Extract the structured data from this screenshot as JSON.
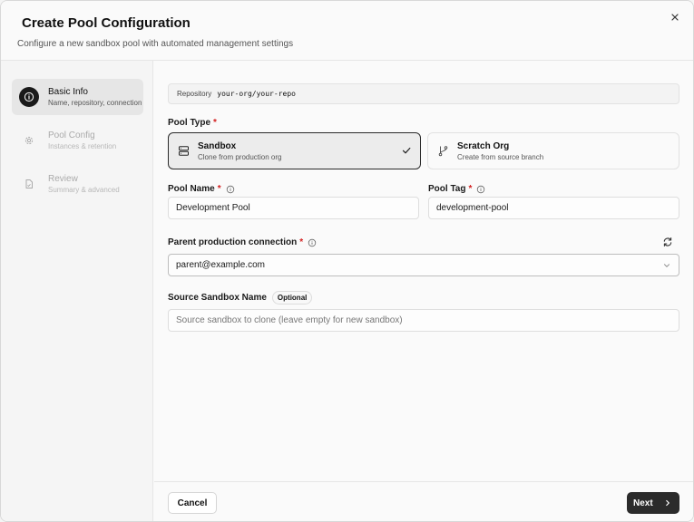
{
  "dialog": {
    "title": "Create Pool Configuration",
    "subtitle": "Configure a new sandbox pool with automated management settings"
  },
  "steps": [
    {
      "label": "Basic Info",
      "description": "Name, repository, connection",
      "active": true,
      "icon": "info-icon"
    },
    {
      "label": "Pool Config",
      "description": "Instances & retention",
      "active": false,
      "icon": "gear-icon"
    },
    {
      "label": "Review",
      "description": "Summary & advanced",
      "active": false,
      "icon": "document-icon"
    }
  ],
  "repository": {
    "label": "Repository",
    "value": "your-org/your-repo"
  },
  "pool_type": {
    "label": "Pool Type",
    "required_mark": "*",
    "options": [
      {
        "title": "Sandbox",
        "description": "Clone from production org",
        "selected": true,
        "icon": "server-icon"
      },
      {
        "title": "Scratch Org",
        "description": "Create from source branch",
        "selected": false,
        "icon": "git-branch-icon"
      }
    ]
  },
  "pool_name": {
    "label": "Pool Name",
    "required_mark": "*",
    "value": "Development Pool"
  },
  "pool_tag": {
    "label": "Pool Tag",
    "required_mark": "*",
    "value": "development-pool"
  },
  "parent_connection": {
    "label": "Parent production connection",
    "required_mark": "*",
    "value": "parent@example.com"
  },
  "source_sandbox": {
    "label": "Source Sandbox Name",
    "badge": "Optional",
    "value": "",
    "placeholder": "Source sandbox to clone (leave empty for new sandbox)"
  },
  "footer": {
    "cancel_label": "Cancel",
    "next_label": "Next"
  },
  "colors": {
    "primary": "#2b2b2b",
    "required": "#d32020",
    "border": "#e2e2e2"
  }
}
